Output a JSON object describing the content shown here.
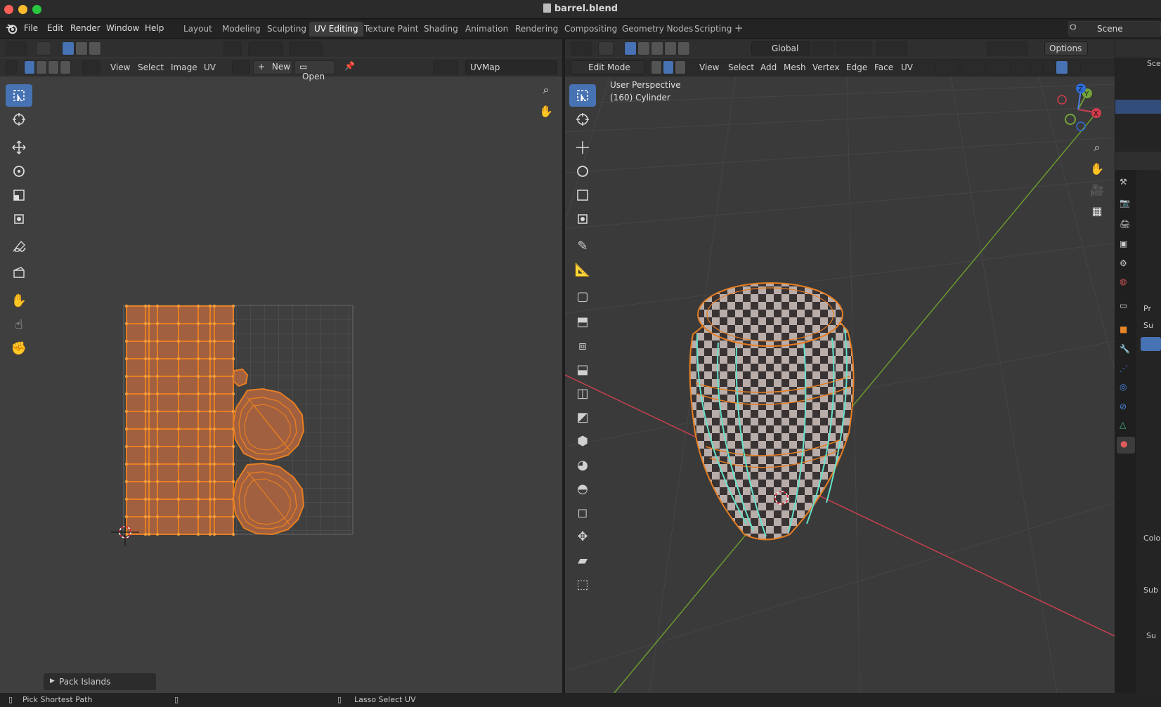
{
  "window": {
    "title": "barrel.blend"
  },
  "menu": [
    "File",
    "Edit",
    "Render",
    "Window",
    "Help"
  ],
  "workspaces": [
    {
      "label": "Layout",
      "active": false
    },
    {
      "label": "Modeling",
      "active": false
    },
    {
      "label": "Sculpting",
      "active": false
    },
    {
      "label": "UV Editing",
      "active": true
    },
    {
      "label": "Texture Paint",
      "active": false
    },
    {
      "label": "Shading",
      "active": false
    },
    {
      "label": "Animation",
      "active": false
    },
    {
      "label": "Rendering",
      "active": false
    },
    {
      "label": "Compositing",
      "active": false
    },
    {
      "label": "Geometry Nodes",
      "active": false
    },
    {
      "label": "Scripting",
      "active": false
    }
  ],
  "scene": {
    "name": "Scene"
  },
  "uv_editor": {
    "menus": [
      "View",
      "Select",
      "Image",
      "UV"
    ],
    "new_label": "New",
    "open_label": "Open",
    "uvmap_value": "UVMap",
    "pack_panel": "Pack Islands"
  },
  "viewport": {
    "mode": "Edit Mode",
    "menus": [
      "View",
      "Select",
      "Add",
      "Mesh",
      "Vertex",
      "Edge",
      "Face",
      "UV"
    ],
    "orientation": "Global",
    "options_label": "Options",
    "view_name": "User Perspective",
    "object_info": "(160) Cylinder",
    "axis_labels": {
      "x": "X",
      "y": "Y",
      "z": "Z"
    }
  },
  "right_panel": {
    "labels": [
      "Sce",
      "Pr",
      "Su",
      "Colo",
      "Sub",
      "Su"
    ]
  },
  "status": {
    "left": "Pick Shortest Path",
    "middle": "Lasso Select UV"
  },
  "colors": {
    "accent": "#4772b3",
    "uv_selected": "#e67e22",
    "x_axis": "#c6404f",
    "y_axis": "#6b9a2e"
  }
}
